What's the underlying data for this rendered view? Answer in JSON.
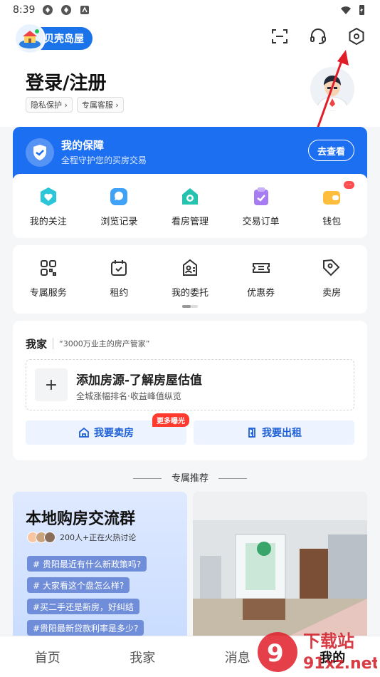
{
  "status_bar": {
    "time": "8:39"
  },
  "header": {
    "logo_text": "贝壳岛屋",
    "login_title": "登录/注册",
    "chips": [
      "隐私保护 ›",
      "专属客服 ›"
    ]
  },
  "guard": {
    "title": "我的保障",
    "subtitle": "全程守护您的买房交易",
    "button": "去查看"
  },
  "row1": [
    {
      "label": "我的关注",
      "icon": "heart-icon",
      "color": "#2bc6d8"
    },
    {
      "label": "浏览记录",
      "icon": "message-icon",
      "color": "#3fa2f7"
    },
    {
      "label": "看房管理",
      "icon": "house-check-icon",
      "color": "#25c2b0"
    },
    {
      "label": "交易订单",
      "icon": "clipboard-check-icon",
      "color": "#a77cf2"
    },
    {
      "label": "钱包",
      "icon": "wallet-icon",
      "color": "#ffbd3b"
    }
  ],
  "row2": [
    {
      "label": "专属服务",
      "icon": "grid-icon"
    },
    {
      "label": "租约",
      "icon": "calendar-check-icon"
    },
    {
      "label": "我的委托",
      "icon": "id-card-icon"
    },
    {
      "label": "优惠券",
      "icon": "ticket-icon"
    },
    {
      "label": "卖房",
      "icon": "tag-icon"
    }
  ],
  "home": {
    "title": "我家",
    "slogan": "“3000万业主的房产管家”",
    "add_title": "添加房源-了解房屋估值",
    "add_sub": "全城涨幅排名·收益峰值纵览",
    "sell_btn": "我要卖房",
    "rent_btn": "我要出租",
    "more_badge": "更多曝光"
  },
  "section_title": "专属推荐",
  "group": {
    "title": "本地购房交流群",
    "people": "200人+正在火热讨论",
    "questions": [
      "# 贵阳最近有什么新政策吗?",
      "# 大家看这个盘怎么样?",
      "#买二手还是新房，好纠结",
      "#贵阳最新贷款利率是多少?"
    ]
  },
  "tabs": [
    "首页",
    "我家",
    "消息",
    "我的"
  ],
  "colors": {
    "accent": "#1d6ff2",
    "badge_red": "#ff3b30"
  }
}
